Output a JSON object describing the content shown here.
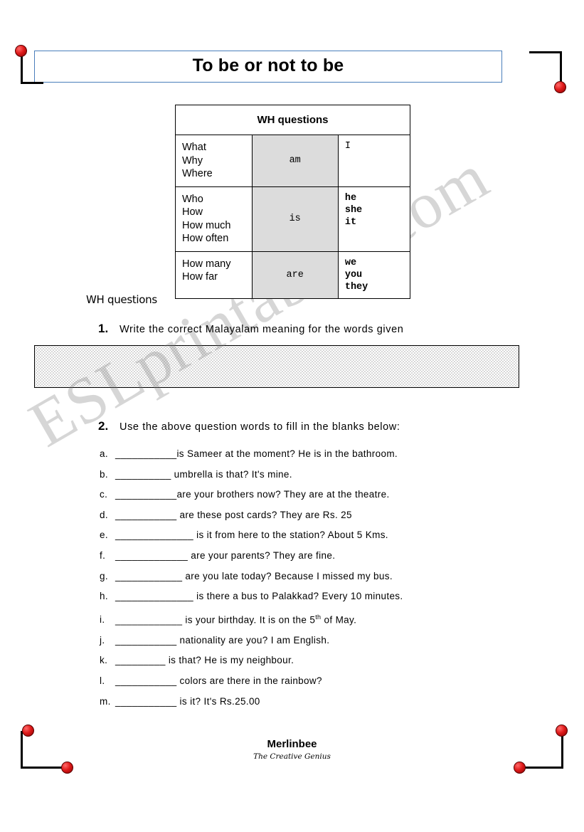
{
  "document": {
    "title": "To be or not to be",
    "grammar_table": {
      "header": "WH questions",
      "rows": [
        {
          "question_words": [
            "What",
            "Why",
            "Where"
          ],
          "verb": "am",
          "pronouns": [
            "I"
          ]
        },
        {
          "question_words": [
            "Who",
            "How",
            "How much",
            "How often"
          ],
          "verb": "is",
          "pronouns": [
            "he",
            "she",
            "it"
          ]
        },
        {
          "question_words": [
            "How many",
            "How far"
          ],
          "verb": "are",
          "pronouns": [
            "we",
            "you",
            "they"
          ]
        }
      ]
    },
    "section_label": "WH questions",
    "exercises": [
      {
        "number": "1.",
        "instruction": "Write the correct Malayalam meaning for the words given"
      },
      {
        "number": "2.",
        "instruction": "Use the above question words to fill in the blanks below:"
      }
    ],
    "blanks": [
      {
        "label": "a.",
        "text": "___________is Sameer at the moment? He is in the bathroom."
      },
      {
        "label": "b.",
        "text": "__________ umbrella is that? It's mine."
      },
      {
        "label": "c.",
        "text": "___________are  your brothers now? They are at the theatre."
      },
      {
        "label": "d.",
        "text": "___________ are these post cards? They are Rs. 25"
      },
      {
        "label": "e.",
        "text": "______________ is it from here to the station? About 5 Kms."
      },
      {
        "label": "f.",
        "text": "_____________ are your parents? They are fine."
      },
      {
        "label": "g.",
        "text": "____________ are you late today? Because I missed my bus."
      },
      {
        "label": "h.",
        "text": "______________ is there a bus to Palakkad? Every 10 minutes."
      },
      {
        "label": "i.",
        "text": "____________ is your birthday. It is on the 5",
        "sup": "th",
        "text_after": " of May."
      },
      {
        "label": "j.",
        "text": "___________ nationality are you? I am English."
      },
      {
        "label": "k.",
        "text": "_________ is that? He is my neighbour."
      },
      {
        "label": "l.",
        "text": "___________ colors are there in the rainbow?"
      },
      {
        "label": "m.",
        "text": "___________ is  it? It's Rs.25.00"
      }
    ],
    "footer": {
      "name": "Merlinbee",
      "tagline": "The Creative Genius"
    },
    "watermark": "ESLprintables.com"
  }
}
